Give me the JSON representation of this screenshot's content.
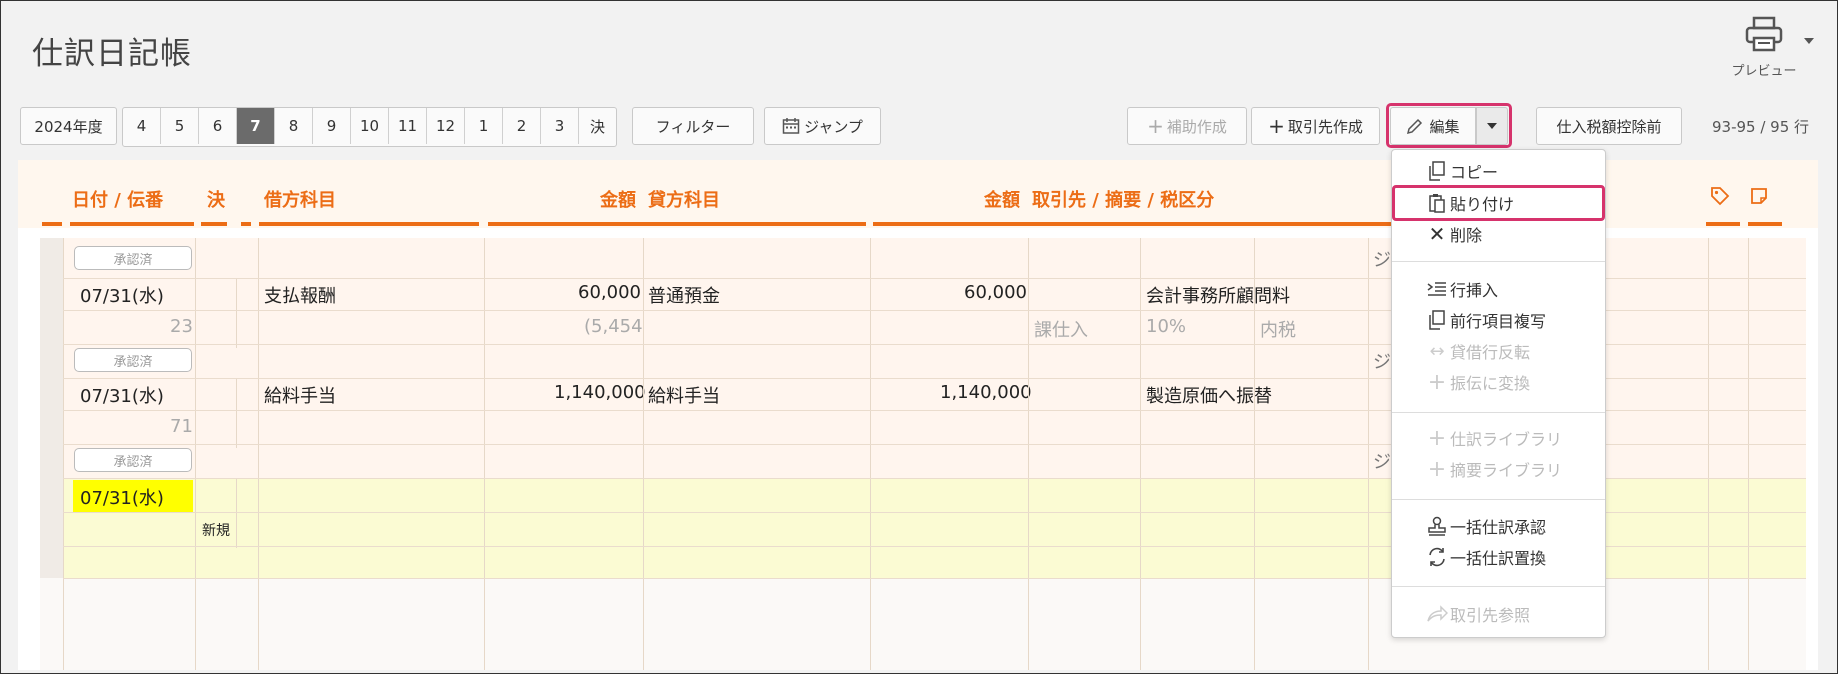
{
  "page": {
    "title": "仕訳日記帳"
  },
  "print": {
    "label": "プレビュー"
  },
  "toolbar": {
    "year_label": "2024年度",
    "months": [
      "4",
      "5",
      "6",
      "7",
      "8",
      "9",
      "10",
      "11",
      "12",
      "1",
      "2",
      "3",
      "決"
    ],
    "active_month": "7",
    "filter_label": "フィルター",
    "jump_label": "ジャンプ",
    "aux_create_label": "補助作成",
    "partner_create_label": "取引先作成",
    "edit_label": "編集",
    "tax_label": "仕入税額控除前",
    "row_count": "93-95 / 95 行"
  },
  "table": {
    "headers": {
      "date": "日付 / 伝番",
      "settle": "決",
      "debit_account": "借方科目",
      "debit_amount": "金額",
      "credit_account": "貸方科目",
      "credit_amount": "金額",
      "partner": "取引先 / 摘要 / 税区分"
    },
    "approved_label": "承認済",
    "rows": [
      {
        "date": "07/31(水)",
        "number": "23",
        "debit": "支払報酬",
        "debit_amount": "60,000",
        "debit_tax": "(5,454",
        "credit": "普通預金",
        "credit_amount": "60,000",
        "memo": "会計事務所顧問料",
        "tax_class": "課仕入",
        "tax_rate": "10%",
        "tax_mode": "内税",
        "overflow": "ジ"
      },
      {
        "date": "07/31(水)",
        "number": "71",
        "debit": "給料手当",
        "debit_amount": "1,140,000",
        "credit": "給料手当",
        "credit_amount": "1,140,000",
        "memo": "製造原価へ振替",
        "overflow": "ジ"
      },
      {
        "date": "07/31(水)",
        "new_label": "新規"
      }
    ],
    "top_overflow": "ジ"
  },
  "menu": {
    "items": [
      {
        "label": "コピー",
        "icon": "copy-icon",
        "enabled": true
      },
      {
        "label": "貼り付け",
        "icon": "paste-icon",
        "enabled": true
      },
      {
        "label": "削除",
        "icon": "close-icon",
        "enabled": true
      },
      {
        "label": "行挿入",
        "icon": "insert-row-icon",
        "enabled": true
      },
      {
        "label": "前行項目複写",
        "icon": "copy-icon",
        "enabled": true
      },
      {
        "label": "貸借行反転",
        "icon": "swap-icon",
        "enabled": false
      },
      {
        "label": "振伝に変換",
        "icon": "plus-icon",
        "enabled": false
      },
      {
        "label": "仕訳ライブラリ",
        "icon": "plus-icon",
        "enabled": false
      },
      {
        "label": "摘要ライブラリ",
        "icon": "plus-icon",
        "enabled": false
      },
      {
        "label": "一括仕訳承認",
        "icon": "stamp-icon",
        "enabled": true
      },
      {
        "label": "一括仕訳置換",
        "icon": "refresh-icon",
        "enabled": true
      },
      {
        "label": "取引先参照",
        "icon": "share-icon",
        "enabled": false
      }
    ]
  },
  "colors": {
    "accent": "#ec6d16",
    "highlight": "#d6336c",
    "selected_date": "#ffff00",
    "new_row": "#fbfbd3"
  }
}
